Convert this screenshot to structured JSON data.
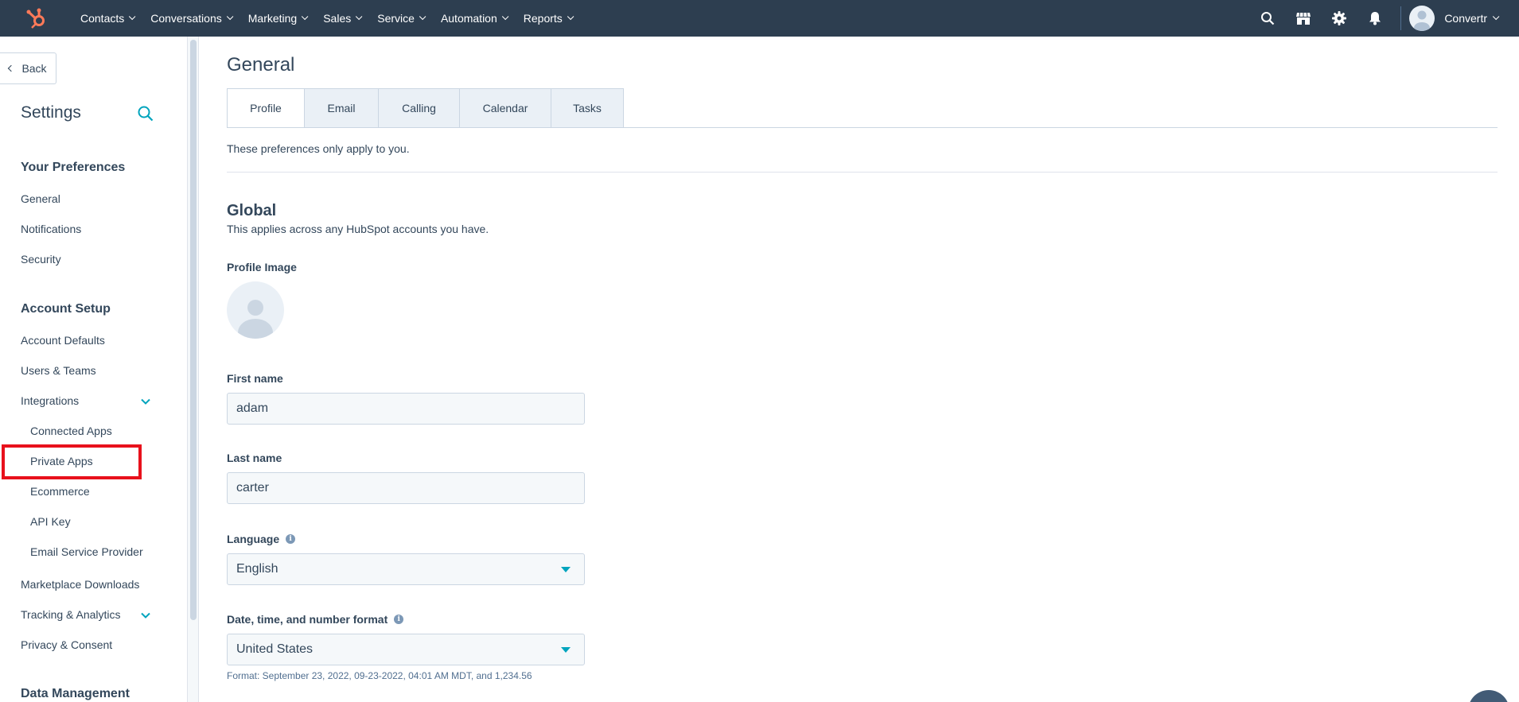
{
  "topnav": {
    "logo_icon": "hubspot-sprocket-icon",
    "items": [
      {
        "label": "Contacts"
      },
      {
        "label": "Conversations"
      },
      {
        "label": "Marketing"
      },
      {
        "label": "Sales"
      },
      {
        "label": "Service"
      },
      {
        "label": "Automation"
      },
      {
        "label": "Reports"
      }
    ],
    "right_icons": [
      "search-icon",
      "marketplace-icon",
      "gear-icon",
      "bell-icon"
    ],
    "account_name": "Convertr"
  },
  "sidebar": {
    "back_label": "Back",
    "title": "Settings",
    "sections": [
      {
        "heading": "Your Preferences",
        "items": [
          {
            "label": "General"
          },
          {
            "label": "Notifications"
          },
          {
            "label": "Security"
          }
        ]
      },
      {
        "heading": "Account Setup",
        "items": [
          {
            "label": "Account Defaults"
          },
          {
            "label": "Users & Teams"
          },
          {
            "label": "Integrations"
          },
          {
            "label": "Marketplace Downloads"
          },
          {
            "label": "Tracking & Analytics"
          },
          {
            "label": "Privacy & Consent"
          }
        ]
      },
      {
        "heading": "Data Management"
      }
    ],
    "integrations_sub": [
      {
        "label": "Connected Apps"
      },
      {
        "label": "Private Apps"
      },
      {
        "label": "Ecommerce"
      },
      {
        "label": "API Key"
      },
      {
        "label": "Email Service Provider"
      }
    ]
  },
  "main": {
    "title": "General",
    "tabs": [
      {
        "label": "Profile"
      },
      {
        "label": "Email"
      },
      {
        "label": "Calling"
      },
      {
        "label": "Calendar"
      },
      {
        "label": "Tasks"
      }
    ],
    "intro": "These preferences only apply to you.",
    "global_title": "Global",
    "global_sub": "This applies across any HubSpot accounts you have.",
    "profile_image_label": "Profile Image",
    "first_name_label": "First name",
    "first_name_value": "adam",
    "last_name_label": "Last name",
    "last_name_value": "carter",
    "language_label": "Language",
    "language_value": "English",
    "format_label": "Date, time, and number format",
    "format_value": "United States",
    "format_note": "Format: September 23, 2022, 09-23-2022, 04:01 AM MDT, and 1,234.56"
  },
  "colors": {
    "nav_bg": "#2d3e50",
    "accent": "#00a4bd",
    "logo": "#ff7a59",
    "highlight": "#e8111c"
  }
}
